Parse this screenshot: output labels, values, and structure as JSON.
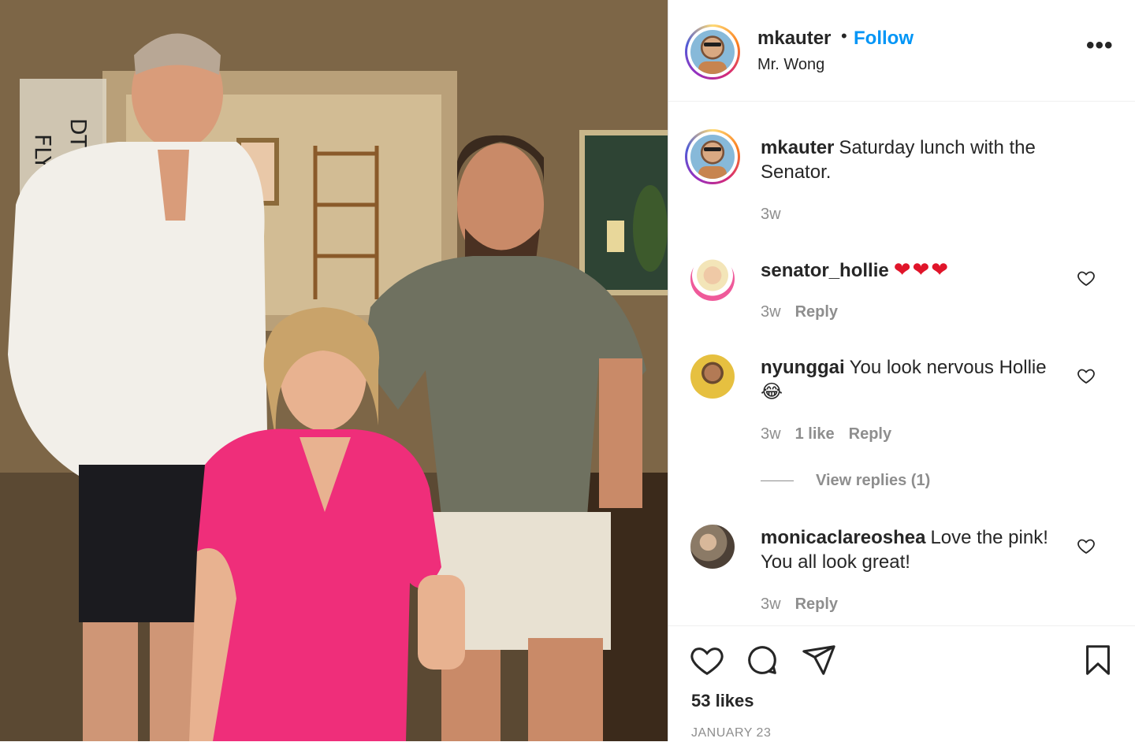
{
  "post": {
    "author": "mkauter",
    "follow_label": "Follow",
    "separator": "•",
    "location": "Mr. Wong",
    "more_label": "•••"
  },
  "caption": {
    "author": "mkauter",
    "text": "Saturday lunch with the Senator.",
    "time": "3w"
  },
  "comments": [
    {
      "author": "senator_hollie",
      "text": "❤❤❤",
      "time": "3w",
      "likes": "",
      "reply": "Reply"
    },
    {
      "author": "nyunggai",
      "text": "You look nervous Hollie 😂",
      "time": "3w",
      "likes": "1 like",
      "reply": "Reply"
    },
    {
      "author": "monicaclareoshea",
      "text": "Love the pink! You all look great!",
      "time": "3w",
      "likes": "",
      "reply": "Reply"
    }
  ],
  "view_replies": "View replies (1)",
  "likes": "53 likes",
  "date": "JANUARY 23",
  "colors": {
    "link": "#0095f6",
    "heart": "#e0152a",
    "muted": "#8e8e8e",
    "text": "#262626"
  },
  "icons": [
    "heart-icon",
    "comment-icon",
    "share-icon",
    "bookmark-icon",
    "more-icon"
  ]
}
